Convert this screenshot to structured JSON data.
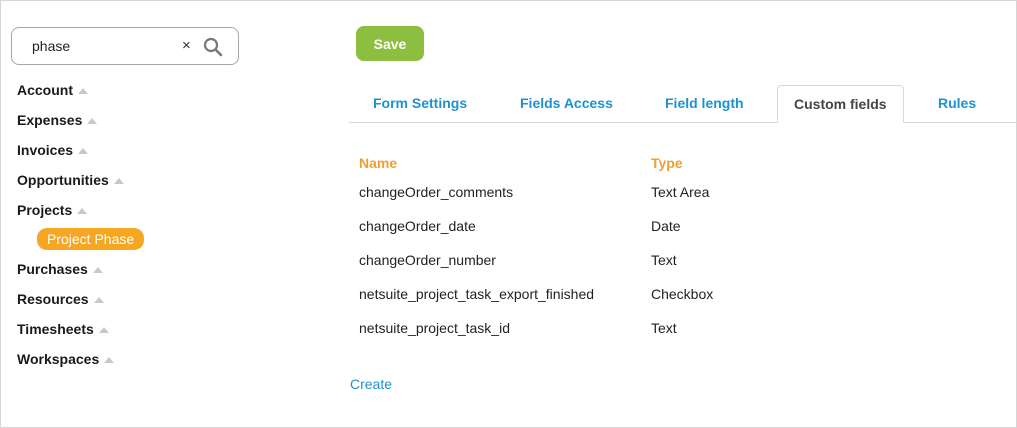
{
  "search": {
    "value": "phase",
    "clear_glyph": "×",
    "icon": "search-icon"
  },
  "sidebar": {
    "items": [
      {
        "label": "Account"
      },
      {
        "label": "Expenses"
      },
      {
        "label": "Invoices"
      },
      {
        "label": "Opportunities"
      },
      {
        "label": "Projects",
        "children": [
          {
            "label": "Project Phase",
            "selected": true
          }
        ]
      },
      {
        "label": "Purchases"
      },
      {
        "label": "Resources"
      },
      {
        "label": "Timesheets"
      },
      {
        "label": "Workspaces"
      }
    ],
    "caret_icon": "caret-up-icon",
    "selected_color": "#f5a623"
  },
  "toolbar": {
    "save_label": "Save",
    "save_color": "#8cbf3f"
  },
  "tabs": [
    {
      "label": "Form Settings",
      "active": false
    },
    {
      "label": "Fields Access",
      "active": false
    },
    {
      "label": "Field length",
      "active": false
    },
    {
      "label": "Custom fields",
      "active": true
    },
    {
      "label": "Rules",
      "active": false
    }
  ],
  "table": {
    "headers": {
      "name": "Name",
      "type": "Type"
    },
    "rows": [
      {
        "name": "changeOrder_comments",
        "type": "Text Area"
      },
      {
        "name": "changeOrder_date",
        "type": "Date"
      },
      {
        "name": "changeOrder_number",
        "type": "Text"
      },
      {
        "name": "netsuite_project_task_export_finished",
        "type": "Checkbox"
      },
      {
        "name": "netsuite_project_task_id",
        "type": "Text"
      }
    ]
  },
  "create_link": "Create",
  "colors": {
    "link": "#1d92d1",
    "header": "#f0a030"
  }
}
